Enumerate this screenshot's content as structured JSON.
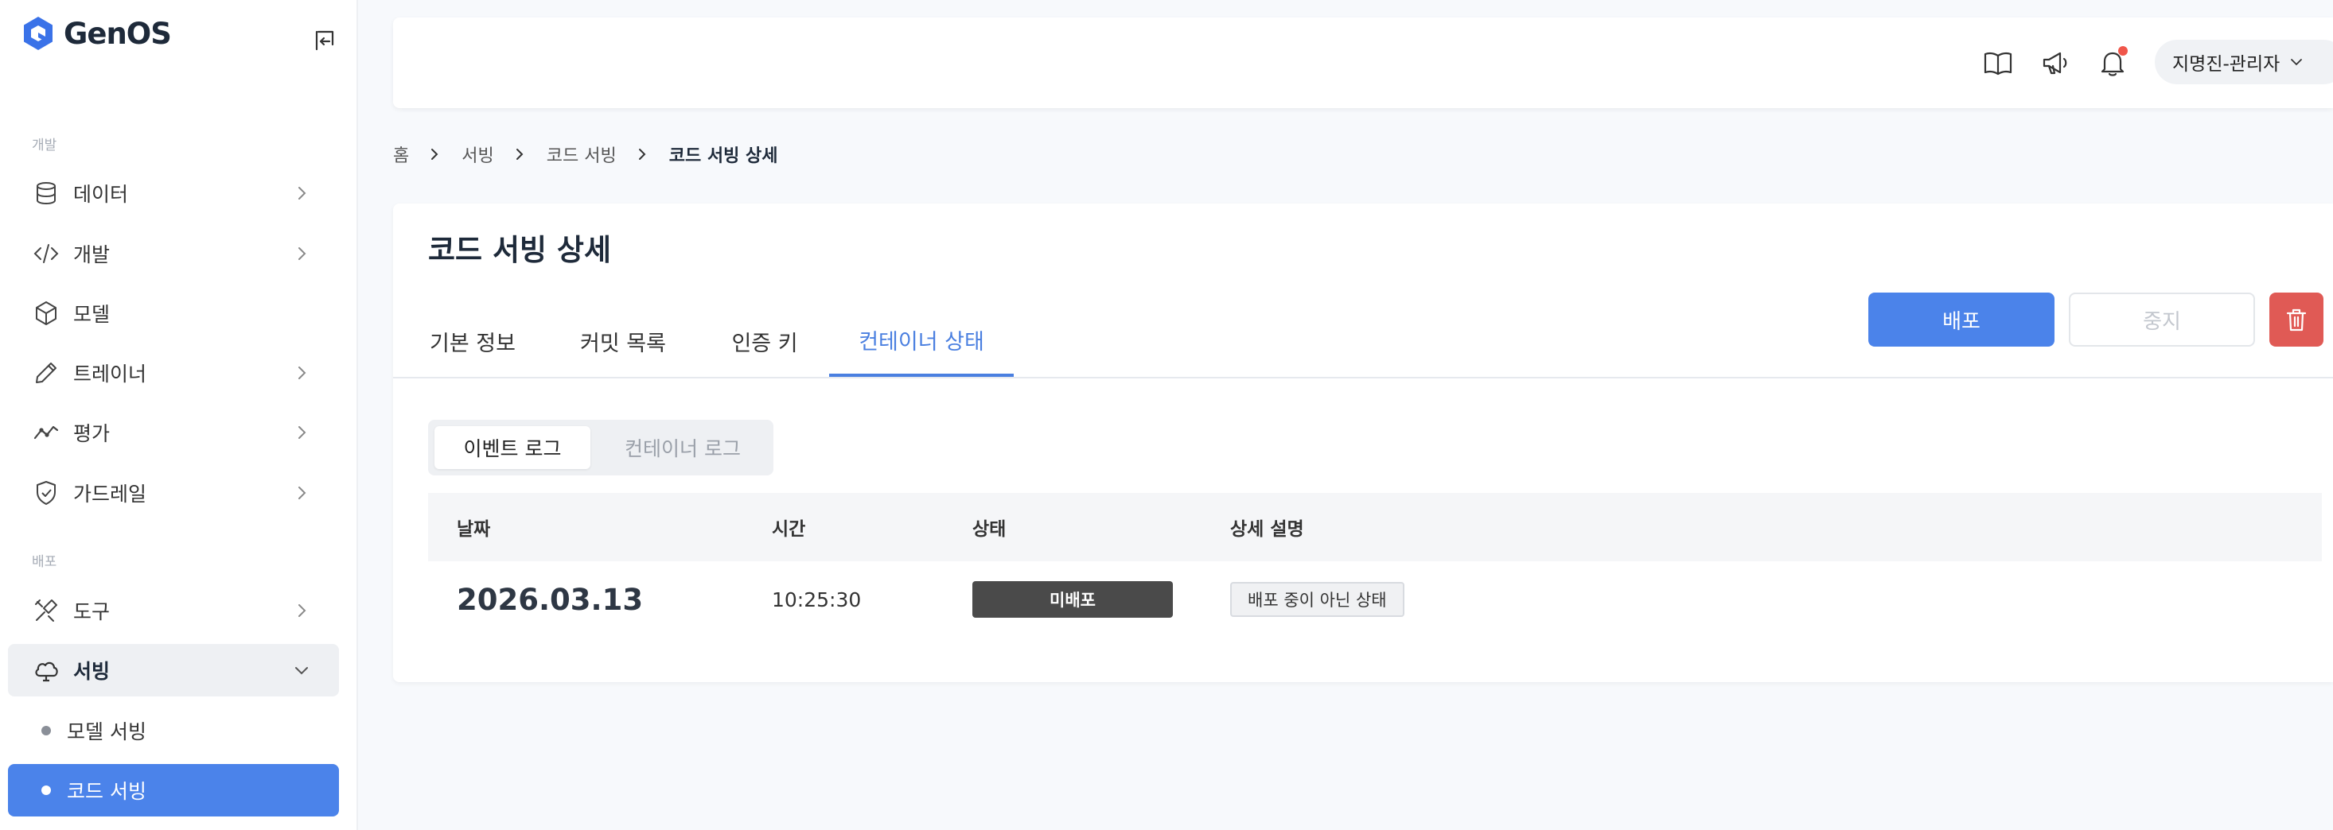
{
  "app": {
    "name": "GenOS"
  },
  "sidebar": {
    "sections": [
      {
        "label": "개발"
      },
      {
        "label": "배포"
      }
    ],
    "items": [
      {
        "label": "데이터",
        "icon": "database-icon",
        "has_children": true
      },
      {
        "label": "개발",
        "icon": "code-icon",
        "has_children": true
      },
      {
        "label": "모델",
        "icon": "cube-icon",
        "has_children": false
      },
      {
        "label": "트레이너",
        "icon": "pencil-icon",
        "has_children": true
      },
      {
        "label": "평가",
        "icon": "chart-line-icon",
        "has_children": true
      },
      {
        "label": "가드레일",
        "icon": "shield-icon",
        "has_children": true
      },
      {
        "label": "도구",
        "icon": "tools-icon",
        "has_children": true
      },
      {
        "label": "서빙",
        "icon": "cloud-icon",
        "has_children": true,
        "expanded": true
      }
    ],
    "sub_items": [
      {
        "label": "모델 서빙",
        "active": false
      },
      {
        "label": "코드 서빙",
        "active": true
      }
    ]
  },
  "header": {
    "icons": [
      "book-icon",
      "megaphone-icon",
      "bell-icon"
    ],
    "user": "지명진-관리자"
  },
  "breadcrumb": [
    "홈",
    "서빙",
    "코드 서빙",
    "코드 서빙 상세"
  ],
  "page": {
    "title": "코드 서빙 상세",
    "tabs": [
      {
        "label": "기본 정보",
        "active": false
      },
      {
        "label": "커밋 목록",
        "active": false
      },
      {
        "label": "인증 키",
        "active": false
      },
      {
        "label": "컨테이너 상태",
        "active": true
      }
    ],
    "actions": {
      "deploy": "배포",
      "stop": "중지"
    },
    "log_tabs": [
      {
        "label": "이벤트 로그",
        "active": true
      },
      {
        "label": "컨테이너 로그",
        "active": false
      }
    ],
    "table": {
      "columns": [
        "날짜",
        "시간",
        "상태",
        "상세 설명"
      ],
      "rows": [
        {
          "date": "2026.03.13",
          "time": "10:25:30",
          "status": "미배포",
          "description": "배포 중이 아닌 상태"
        }
      ]
    }
  },
  "colors": {
    "accent": "#4b83ea",
    "danger": "#e05a55",
    "status_badge": "#4a4a4a",
    "notification_dot": "#f0564a"
  }
}
